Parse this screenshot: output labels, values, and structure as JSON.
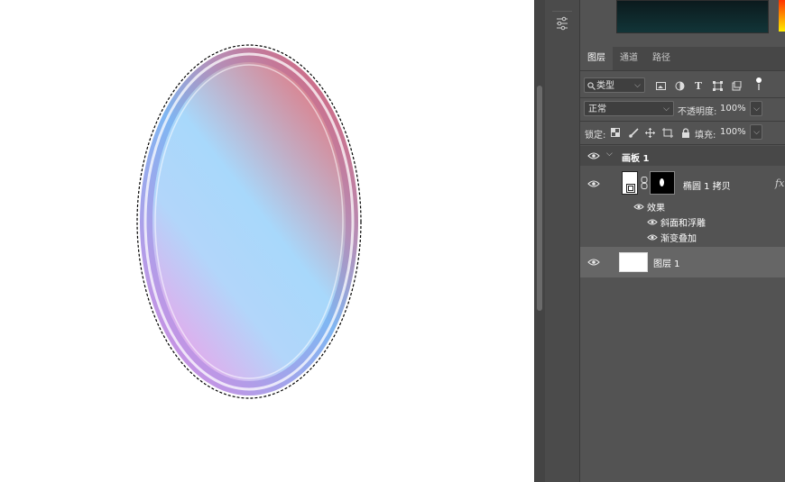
{
  "tabs": [
    {
      "label": "图层"
    },
    {
      "label": "通道"
    },
    {
      "label": "路径"
    }
  ],
  "filter": {
    "kind_label": "类型"
  },
  "blend": {
    "mode": "正常",
    "opacity_label": "不透明度:",
    "opacity_value": "100%"
  },
  "lock": {
    "label": "锁定:",
    "fill_label": "填充:",
    "fill_value": "100%"
  },
  "layers": {
    "artboard": {
      "name": "画板 1"
    },
    "ellipse": {
      "name": "椭圆 1 拷贝",
      "fx": "fx",
      "effects_label": "效果",
      "effects": [
        "斜面和浮雕",
        "渐变叠加"
      ]
    },
    "layer1": {
      "name": "图层 1"
    }
  },
  "colors": {
    "panel": "#535353",
    "canvas": "#ffffff",
    "ellipse_top_right": "#e07a84",
    "ellipse_center": "#a8d8fb",
    "ellipse_bottom_left": "#e8a6ea"
  },
  "icons": [
    "adjustments-icon",
    "search-icon",
    "image-filter-icon",
    "adjustment-filter-icon",
    "text-filter-icon",
    "shape-filter-icon",
    "smartobject-filter-icon",
    "filter-toggle-icon",
    "lock-pixels-icon",
    "lock-brush-icon",
    "lock-position-icon",
    "lock-artboard-icon",
    "lock-all-icon",
    "eye-icon",
    "chevron-down-icon",
    "link-icon",
    "mask-icon"
  ]
}
